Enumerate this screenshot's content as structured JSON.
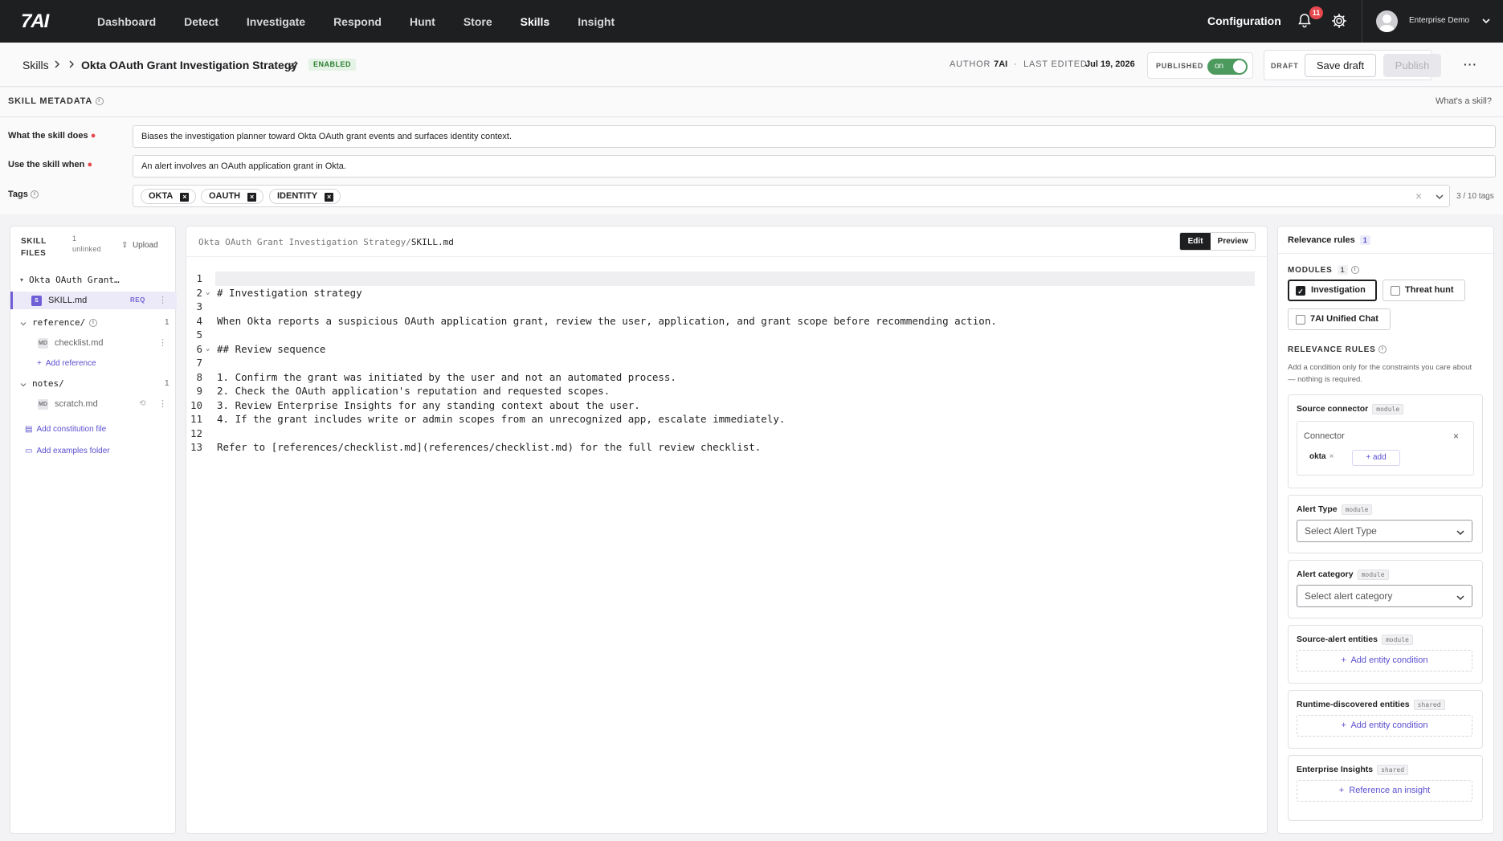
{
  "nav": {
    "logo": "7AI",
    "items": [
      "Dashboard",
      "Detect",
      "Investigate",
      "Respond",
      "Hunt",
      "Store",
      "Skills",
      "Insight"
    ],
    "active": "Skills",
    "configuration": "Configuration",
    "notification_count": "11",
    "user_name": "Enterprise Demo"
  },
  "header": {
    "breadcrumb_root": "Skills",
    "title": "Okta OAuth Grant Investigation Strategy",
    "status_badge": "ENABLED",
    "author_label": "AUTHOR",
    "author": "7AI",
    "separator": "·",
    "last_edited_label": "LAST EDITED",
    "last_edited": "Jul 19, 2026",
    "published_label": "PUBLISHED",
    "published_toggle": "on",
    "draft_label": "DRAFT",
    "save_draft": "Save draft",
    "publish": "Publish",
    "more": "···"
  },
  "metadata": {
    "section_title": "SKILL METADATA",
    "whats_a_skill": "What's a skill?",
    "what_label": "What the skill does",
    "what_value": "Biases the investigation planner toward Okta OAuth grant events and surfaces identity context.",
    "when_label": "Use the skill when",
    "when_value": "An alert involves an OAuth application grant in Okta.",
    "tags_label": "Tags",
    "tags": [
      "OKTA",
      "OAUTH",
      "IDENTITY"
    ],
    "tag_count": "3 / 10 tags"
  },
  "files": {
    "title_line1": "SKILL",
    "title_line2": "FILES",
    "unlinked_count": "1",
    "unlinked_label": "unlinked",
    "upload": "Upload",
    "root_folder": "Okta OAuth Grant…",
    "skill_file": "SKILL.md",
    "skill_icon": "S",
    "req": "REQ",
    "reference_folder": "reference/",
    "reference_count": "1",
    "checklist_file": "checklist.md",
    "md_icon": "MD",
    "add_reference": "Add reference",
    "notes_folder": "notes/",
    "notes_count": "1",
    "scratch_file": "scratch.md",
    "add_constitution": "Add constitution file",
    "add_examples": "Add examples folder"
  },
  "editor": {
    "path_prefix": "Okta OAuth Grant Investigation Strategy/",
    "path_file": "SKILL.md",
    "tab_edit": "Edit",
    "tab_preview": "Preview",
    "lines": [
      {
        "n": "1",
        "text": "",
        "fold": false
      },
      {
        "n": "2",
        "text": "# Investigation strategy",
        "fold": true
      },
      {
        "n": "3",
        "text": "",
        "fold": false
      },
      {
        "n": "4",
        "text": "When Okta reports a suspicious OAuth application grant, review the user, application, and grant scope before recommending action.",
        "fold": false
      },
      {
        "n": "5",
        "text": "",
        "fold": false
      },
      {
        "n": "6",
        "text": "## Review sequence",
        "fold": true
      },
      {
        "n": "7",
        "text": "",
        "fold": false
      },
      {
        "n": "8",
        "text": "1. Confirm the grant was initiated by the user and not an automated process.",
        "fold": false
      },
      {
        "n": "9",
        "text": "2. Check the OAuth application's reputation and requested scopes.",
        "fold": false
      },
      {
        "n": "10",
        "text": "3. Review Enterprise Insights for any standing context about the user.",
        "fold": false
      },
      {
        "n": "11",
        "text": "4. If the grant includes write or admin scopes from an unrecognized app, escalate immediately.",
        "fold": false
      },
      {
        "n": "12",
        "text": "",
        "fold": false
      },
      {
        "n": "13",
        "text": "Refer to [references/checklist.md](references/checklist.md) for the full review checklist.",
        "fold": false
      }
    ]
  },
  "relevance": {
    "title": "Relevance rules",
    "title_count": "1",
    "modules_label": "MODULES",
    "modules_count": "1",
    "modules": [
      {
        "label": "Investigation",
        "checked": true
      },
      {
        "label": "Threat hunt",
        "checked": false
      },
      {
        "label": "7AI Unified Chat",
        "checked": false
      }
    ],
    "rules_label": "RELEVANCE RULES",
    "rules_desc": "Add a condition only for the constraints you care about — nothing is required.",
    "source_connector": "Source connector",
    "scope_module": "module",
    "scope_shared": "shared",
    "connector_label": "Connector",
    "connector_value": "okta",
    "add": "+ add",
    "alert_type": "Alert Type",
    "alert_type_placeholder": "Select Alert Type",
    "alert_category": "Alert category",
    "alert_category_placeholder": "Select alert category",
    "source_entities": "Source-alert entities",
    "add_entity": "Add entity condition",
    "runtime_entities": "Runtime-discovered entities",
    "enterprise_insights": "Enterprise Insights",
    "reference_insight": "Reference an insight"
  },
  "colors": {
    "accent": "#5a4fcf",
    "nav_bg": "#1e1f21",
    "toggle_on": "#4c9a5e",
    "required": "#e5484d"
  }
}
